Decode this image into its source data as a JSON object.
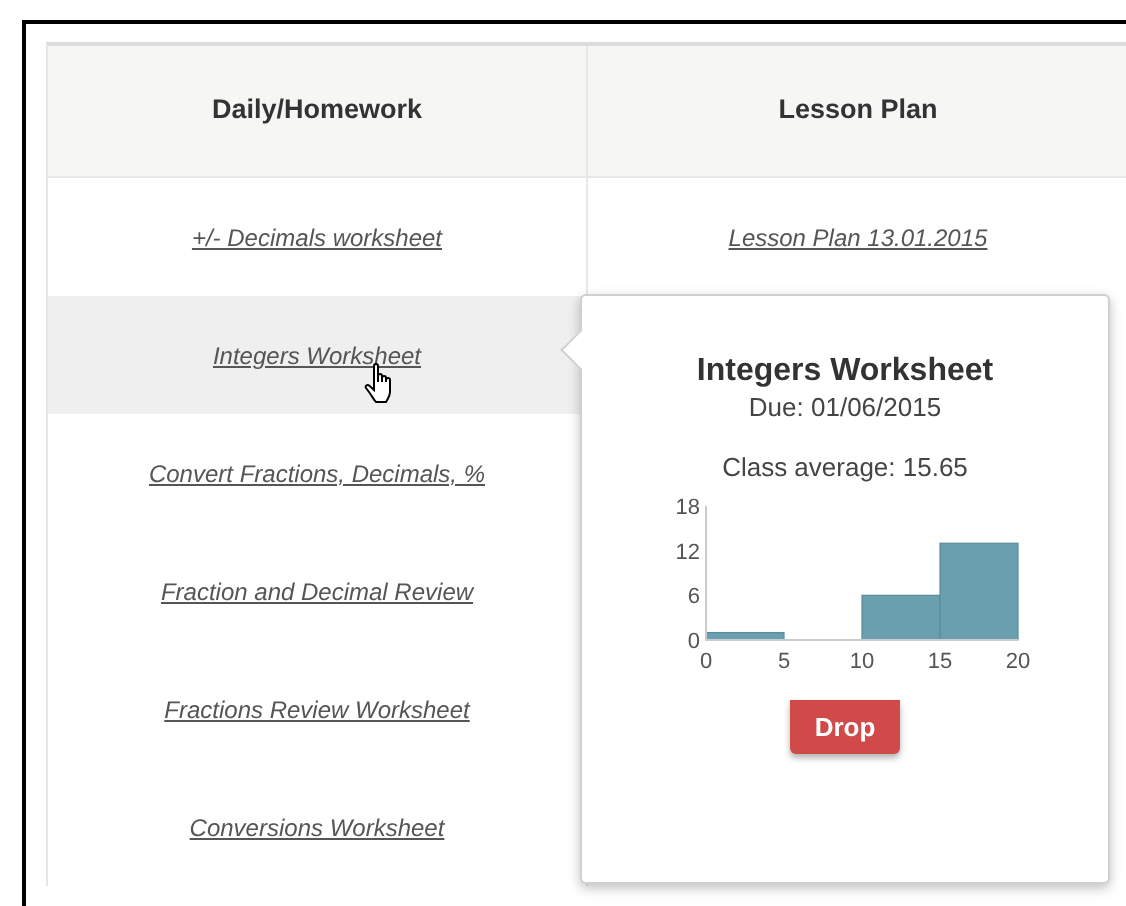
{
  "table": {
    "columns": [
      "Daily/Homework",
      "Lesson Plan"
    ],
    "rows": [
      {
        "homework": "+/- Decimals worksheet",
        "lesson_plan": "Lesson Plan 13.01.2015",
        "hovered": false
      },
      {
        "homework": "Integers Worksheet",
        "hovered": true
      },
      {
        "homework": "Convert Fractions, Decimals, %",
        "hovered": false
      },
      {
        "homework": "Fraction and Decimal Review",
        "hovered": false
      },
      {
        "homework": "Fractions Review Worksheet",
        "hovered": false
      },
      {
        "homework": "Conversions Worksheet",
        "hovered": false
      }
    ]
  },
  "popover": {
    "title": "Integers Worksheet",
    "due": "Due: 01/06/2015",
    "average": "Class average: 15.65",
    "chart_data": {
      "type": "bar",
      "x": [
        2.5,
        7.5,
        12.5,
        17.5
      ],
      "values": [
        1,
        0,
        6,
        13
      ],
      "xlim": [
        0,
        20
      ],
      "ylim": [
        0,
        18
      ],
      "xticks": [
        0,
        5,
        10,
        15,
        20
      ],
      "yticks": [
        0,
        6,
        12,
        18
      ]
    },
    "button": "Drop"
  }
}
